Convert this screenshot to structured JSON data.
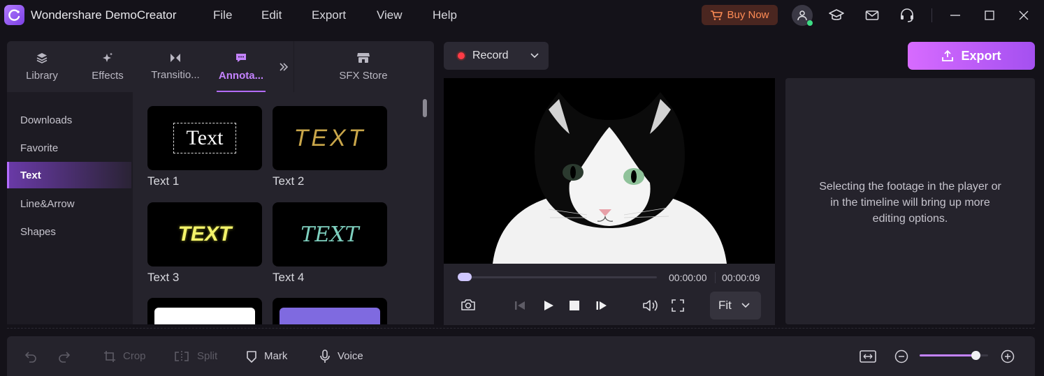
{
  "app": {
    "title": "Wondershare DemoCreator"
  },
  "menu": {
    "file": "File",
    "edit": "Edit",
    "export": "Export",
    "view": "View",
    "help": "Help"
  },
  "header": {
    "buy_now": "Buy Now"
  },
  "tabs": [
    {
      "label": "Library",
      "icon": "layers-icon"
    },
    {
      "label": "Effects",
      "icon": "sparkle-icon"
    },
    {
      "label": "Transitio...",
      "icon": "bowtie-icon"
    },
    {
      "label": "Annota...",
      "icon": "comment-icon",
      "active": true
    },
    {
      "label": "SFX Store",
      "icon": "store-icon"
    }
  ],
  "sidebar": {
    "items": [
      {
        "label": "Downloads"
      },
      {
        "label": "Favorite"
      },
      {
        "label": "Text",
        "active": true
      },
      {
        "label": "Line&Arrow"
      },
      {
        "label": "Shapes"
      }
    ]
  },
  "grid": {
    "items": [
      {
        "label": "Text 1",
        "preview": "Text"
      },
      {
        "label": "Text 2",
        "preview": "TEXT"
      },
      {
        "label": "Text 3",
        "preview": "TEXT"
      },
      {
        "label": "Text 4",
        "preview": "TEXT"
      }
    ]
  },
  "record": {
    "label": "Record"
  },
  "export_button": {
    "label": "Export"
  },
  "player": {
    "current_time": "00:00:00",
    "total_time": "00:00:09",
    "fit": "Fit",
    "progress": 0.0
  },
  "right_panel": {
    "hint": "Selecting the footage in the player or in the timeline will bring up more editing options."
  },
  "bottom_toolbar": {
    "crop": "Crop",
    "split": "Split",
    "mark": "Mark",
    "voice": "Voice",
    "zoom_level": 0.82
  },
  "colors": {
    "accent": "#b46cff",
    "export_gradient_start": "#d76bff",
    "export_gradient_end": "#a450f0",
    "buy_now": "#ff8c55",
    "record": "#ff3b46"
  }
}
